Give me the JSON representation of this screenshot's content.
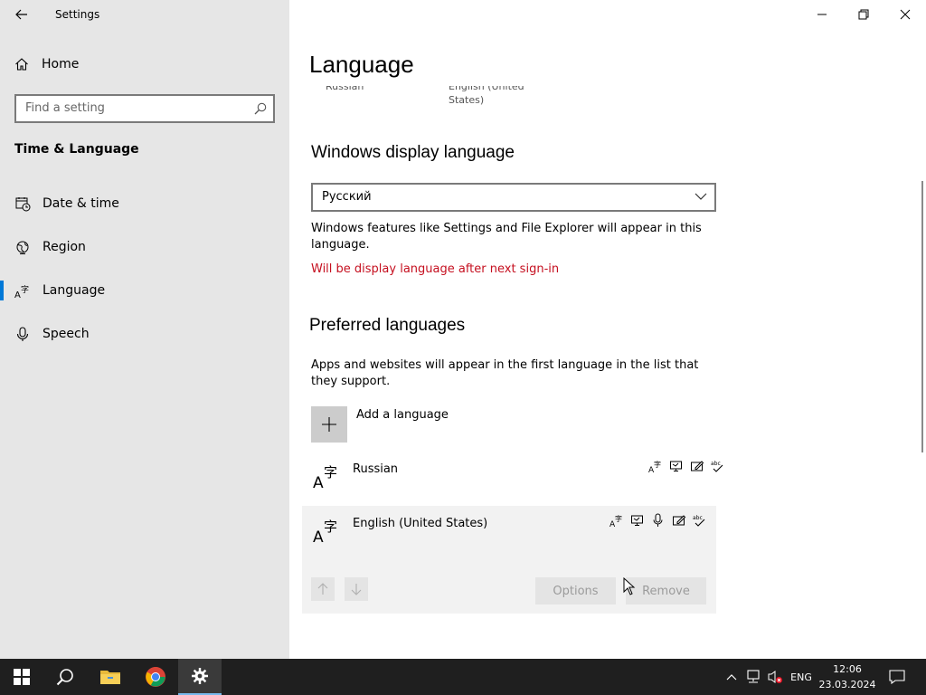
{
  "window": {
    "title": "Settings",
    "controls": [
      "minimize",
      "restore",
      "close"
    ]
  },
  "sidebar": {
    "home_label": "Home",
    "search_placeholder": "Find a setting",
    "section_title": "Time & Language",
    "items": [
      {
        "label": "Date & time",
        "icon": "calendar-clock-icon",
        "active": false
      },
      {
        "label": "Region",
        "icon": "globe-icon",
        "active": false
      },
      {
        "label": "Language",
        "icon": "language-icon",
        "active": true
      },
      {
        "label": "Speech",
        "icon": "microphone-icon",
        "active": false
      }
    ]
  },
  "main": {
    "title": "Language",
    "peek_left": "Russian",
    "peek_right_line1": "English (United",
    "peek_right_line2": "States)",
    "display_language": {
      "heading": "Windows display language",
      "selected": "Русский",
      "description": "Windows features like Settings and File Explorer will appear in this language.",
      "warning": "Will be display language after next sign-in"
    },
    "preferred": {
      "heading": "Preferred languages",
      "description": "Apps and websites will appear in the first language in the list that they support.",
      "add_label": "Add a language",
      "languages": [
        {
          "name": "Russian",
          "features": [
            "display-language-icon",
            "text-to-speech-icon",
            "handwriting-icon",
            "spell-check-icon"
          ],
          "selected": false
        },
        {
          "name": "English (United States)",
          "features": [
            "display-language-icon",
            "text-to-speech-icon",
            "speech-recognition-icon",
            "handwriting-icon",
            "spell-check-icon"
          ],
          "selected": true
        }
      ],
      "options_label": "Options",
      "remove_label": "Remove"
    }
  },
  "taskbar": {
    "apps": [
      "start-icon",
      "search-icon",
      "file-explorer-icon",
      "chrome-icon",
      "settings-icon"
    ],
    "input_language": "ENG",
    "time": "12:06",
    "date": "23.03.2024"
  },
  "colors": {
    "accent": "#0078d7",
    "warning": "#c50f1f",
    "sidebar_bg": "#e6e6e6",
    "taskbar_bg": "#1f1f1f"
  }
}
